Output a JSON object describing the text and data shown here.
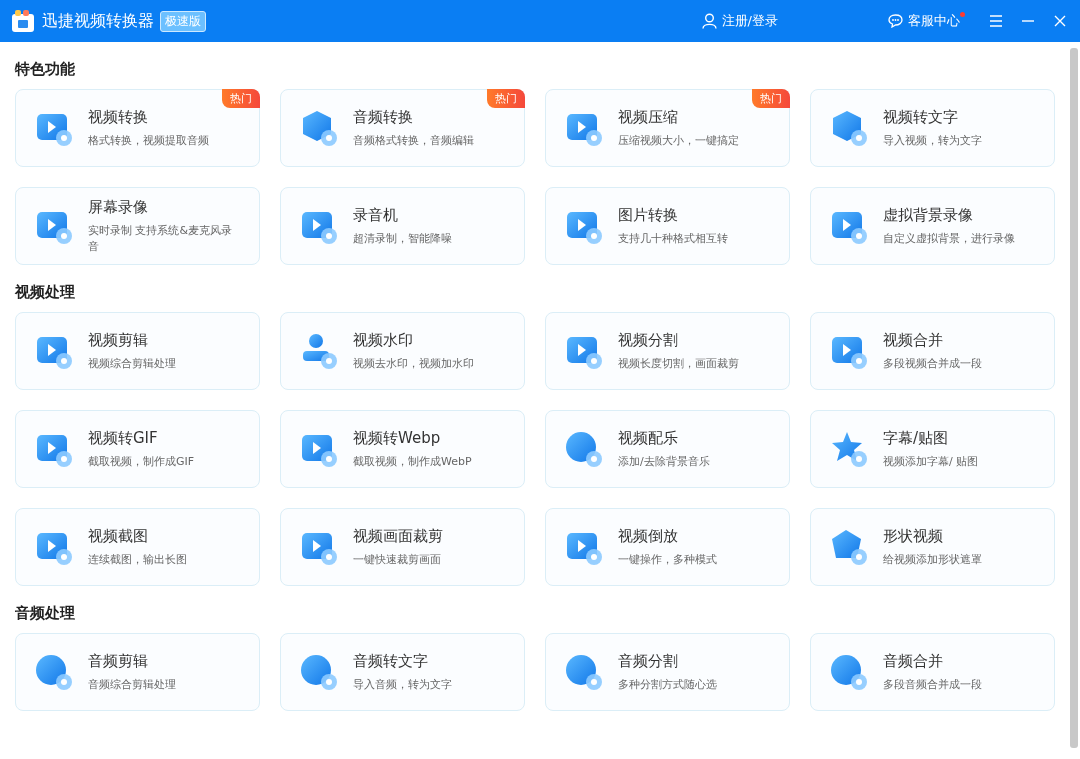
{
  "window": {
    "title": "迅捷视频转换器",
    "edition": "极速版",
    "login": "注册/登录",
    "support": "客服中心",
    "support_notice": true
  },
  "sections": [
    {
      "title": "特色功能",
      "cards": [
        {
          "name": "视频转换",
          "desc": "格式转换，视频提取音频",
          "badge": "热门"
        },
        {
          "name": "音频转换",
          "desc": "音频格式转换，音频编辑",
          "badge": "热门"
        },
        {
          "name": "视频压缩",
          "desc": "压缩视频大小，一键搞定",
          "badge": "热门"
        },
        {
          "name": "视频转文字",
          "desc": "导入视频，转为文字"
        },
        {
          "name": "屏幕录像",
          "desc": "实时录制 支持系统&麦克风录音"
        },
        {
          "name": "录音机",
          "desc": "超清录制，智能降噪"
        },
        {
          "name": "图片转换",
          "desc": "支持几十种格式相互转"
        },
        {
          "name": "虚拟背景录像",
          "desc": "自定义虚拟背景，进行录像"
        }
      ]
    },
    {
      "title": "视频处理",
      "cards": [
        {
          "name": "视频剪辑",
          "desc": "视频综合剪辑处理"
        },
        {
          "name": "视频水印",
          "desc": "视频去水印，视频加水印"
        },
        {
          "name": "视频分割",
          "desc": "视频长度切割，画面裁剪"
        },
        {
          "name": "视频合并",
          "desc": "多段视频合并成一段"
        },
        {
          "name": "视频转GIF",
          "desc": "截取视频，制作成GIF"
        },
        {
          "name": "视频转Webp",
          "desc": "截取视频，制作成WebP"
        },
        {
          "name": "视频配乐",
          "desc": "添加/去除背景音乐"
        },
        {
          "name": "字幕/贴图",
          "desc": "视频添加字幕/ 贴图"
        },
        {
          "name": "视频截图",
          "desc": "连续截图，输出长图"
        },
        {
          "name": "视频画面裁剪",
          "desc": "一键快速裁剪画面"
        },
        {
          "name": "视频倒放",
          "desc": "一键操作，多种模式"
        },
        {
          "name": "形状视频",
          "desc": "给视频添加形状遮罩"
        }
      ]
    },
    {
      "title": "音频处理",
      "cards": [
        {
          "name": "音频剪辑",
          "desc": "音频综合剪辑处理"
        },
        {
          "name": "音频转文字",
          "desc": "导入音频，转为文字"
        },
        {
          "name": "音频分割",
          "desc": "多种分割方式随心选"
        },
        {
          "name": "音频合并",
          "desc": "多段音频合并成一段"
        }
      ]
    }
  ]
}
